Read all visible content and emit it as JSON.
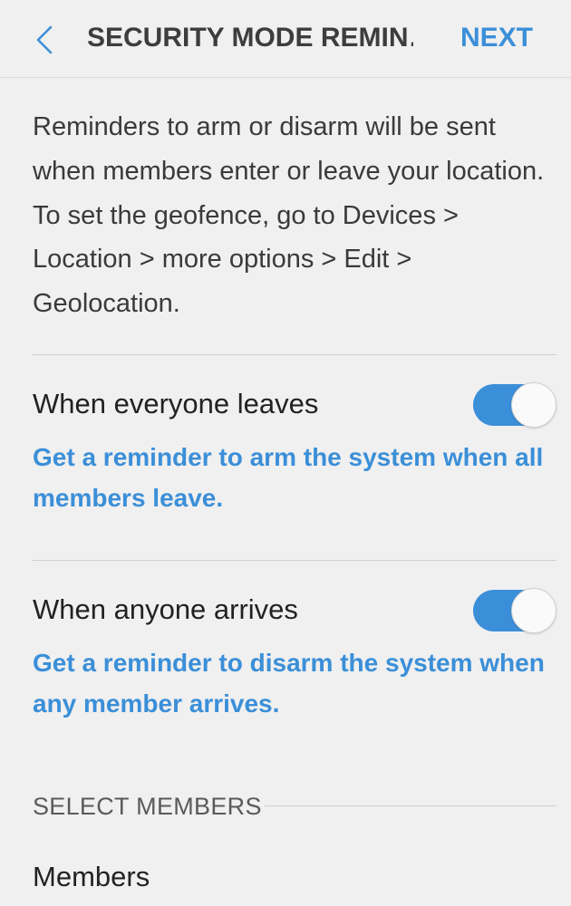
{
  "header": {
    "title": "SECURITY MODE REMIN…",
    "next_label": "NEXT",
    "back_icon": "chevron-left-icon"
  },
  "description": "Reminders to arm or disarm will be sent when members enter or leave your location. To set the geofence, go to Devices > Location > more options > Edit > Geolocation.",
  "reminders": [
    {
      "title": "When everyone leaves",
      "subtitle": "Get a reminder to arm the system when all members leave.",
      "enabled": true
    },
    {
      "title": "When anyone arrives",
      "subtitle": "Get a reminder to disarm the system when any member arrives.",
      "enabled": true
    }
  ],
  "select_members": {
    "header": "SELECT MEMBERS",
    "item_label": "Members"
  },
  "colors": {
    "accent": "#3b8fd8",
    "background": "#f0f0f0",
    "text": "#222222",
    "divider": "#cfcfcf"
  }
}
